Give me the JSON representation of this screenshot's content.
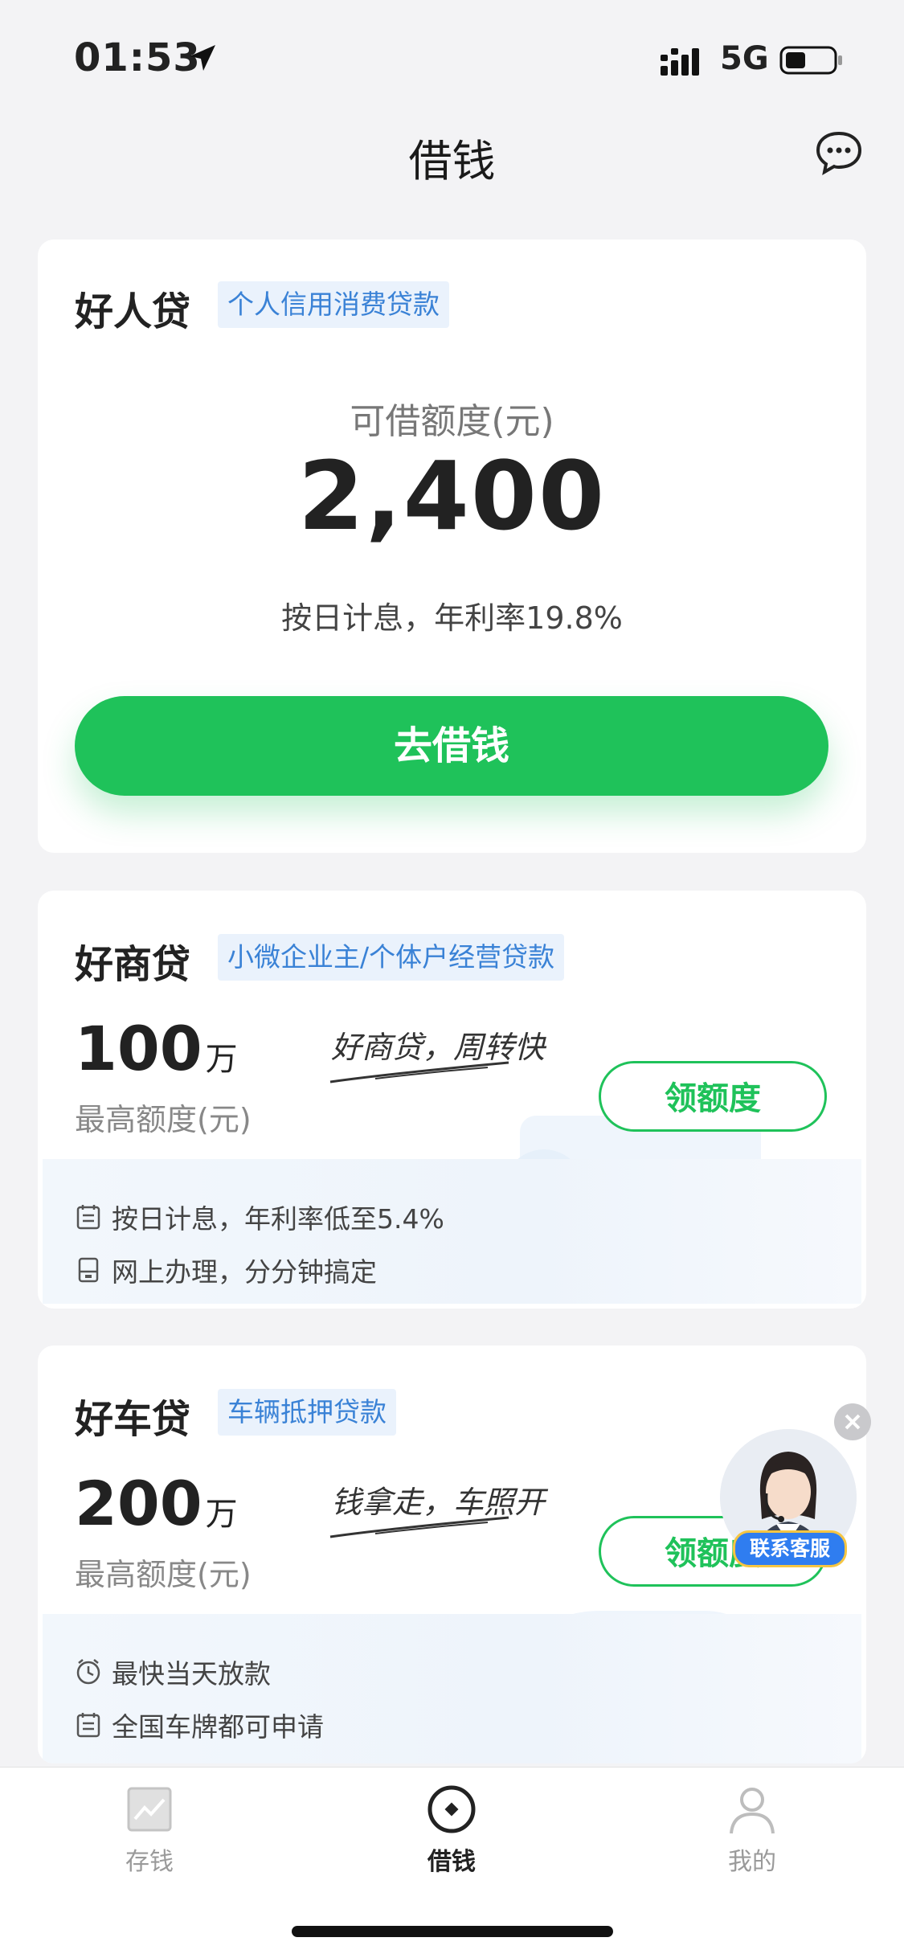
{
  "status_bar": {
    "time": "01:53",
    "network": "5G"
  },
  "header": {
    "title": "借钱"
  },
  "cards": [
    {
      "name": "好人贷",
      "tag": "个人信用消费贷款",
      "quota_label": "可借额度(元)",
      "quota_amount": "2,400",
      "rate_text": "按日计息，年利率19.8%",
      "button": "去借钱"
    },
    {
      "name": "好商贷",
      "tag": "小微企业主/个体户经营贷款",
      "amount": "100",
      "amount_unit": "万",
      "max_label": "最高额度(元)",
      "slogan": "好商贷，周转快",
      "button": "领额度",
      "features": [
        "按日计息，年利率低至5.4%",
        "网上办理，分分钟搞定"
      ]
    },
    {
      "name": "好车贷",
      "tag": "车辆抵押贷款",
      "amount": "200",
      "amount_unit": "万",
      "max_label": "最高额度(元)",
      "slogan": "钱拿走，车照开",
      "button": "领额度",
      "features": [
        "最快当天放款",
        "全国车牌都可申请"
      ]
    }
  ],
  "customer_service": {
    "label": "联系客服"
  },
  "tab_bar": {
    "items": [
      {
        "label": "存钱",
        "icon": "chart-icon",
        "active": false
      },
      {
        "label": "借钱",
        "icon": "loan-icon",
        "active": true
      },
      {
        "label": "我的",
        "icon": "person-icon",
        "active": false
      }
    ]
  },
  "colors": {
    "accent": "#1fc25a",
    "tag_text": "#3a82d6",
    "tag_bg": "#eaf2fc"
  }
}
